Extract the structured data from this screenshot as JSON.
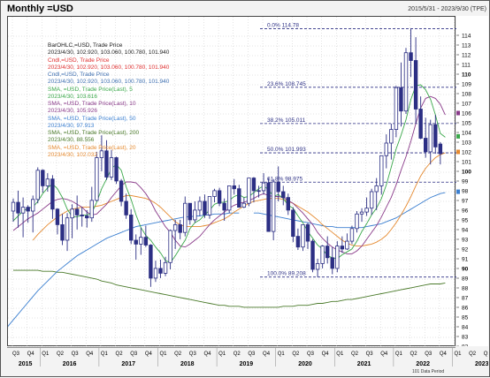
{
  "header": {
    "title": "Monthly =USD",
    "date_range": "2015/5/31 - 2023/9/30 (TPE)"
  },
  "legend": [
    {
      "text": "BarOHLC,=USD, Trade Price",
      "color": "#222222"
    },
    {
      "text": "2023/4/30, 102.920, 103.060, 100.780, 101.940",
      "color": "#222222"
    },
    {
      "text": "Cndl,=USD, Trade Price",
      "color": "#e03030"
    },
    {
      "text": "2023/4/30, 102.920, 103.060, 100.780, 101.940",
      "color": "#e03030"
    },
    {
      "text": "Cndl,=USD, Trade Price",
      "color": "#3e6fb0"
    },
    {
      "text": "2023/4/30, 102.920, 103.060, 100.780, 101.940",
      "color": "#3e6fb0"
    },
    {
      "text": "SMA, =USD, Trade Price(Last), 5",
      "color": "#3aa84a"
    },
    {
      "text": "2023/4/30, 103.616",
      "color": "#3aa84a"
    },
    {
      "text": "SMA, =USD, Trade Price(Last), 10",
      "color": "#8a3b8a"
    },
    {
      "text": "2023/4/30, 105.926",
      "color": "#8a3b8a"
    },
    {
      "text": "SMA, =USD, Trade Price(Last), 50",
      "color": "#3b7fd0"
    },
    {
      "text": "2023/4/30, 97.913",
      "color": "#3b7fd0"
    },
    {
      "text": "SMA, =USD, Trade Price(Last), 200",
      "color": "#4a7a2a"
    },
    {
      "text": "2023/4/30, 88.556",
      "color": "#4a7a2a"
    },
    {
      "text": "SMA, =USD, Trade Price(Last), 20",
      "color": "#e58a30"
    },
    {
      "text": "2023/4/30, 102.032",
      "color": "#e58a30"
    }
  ],
  "footnote": "101 Data Period",
  "chart_data": {
    "type": "candlestick",
    "ylim": [
      82,
      116
    ],
    "y_ticks": [
      82,
      83,
      84,
      85,
      86,
      87,
      88,
      89,
      90,
      91,
      92,
      93,
      94,
      95,
      96,
      97,
      98,
      99,
      100,
      101,
      102,
      103,
      104,
      105,
      106,
      107,
      108,
      109,
      110,
      111,
      112,
      113,
      114
    ],
    "y_ticks_bold": [
      90,
      100,
      110
    ],
    "quarter_labels": [
      "Q3",
      "Q4",
      "Q1",
      "Q2",
      "Q3",
      "Q4",
      "Q1",
      "Q2",
      "Q3",
      "Q4",
      "Q1",
      "Q2",
      "Q3",
      "Q4",
      "Q1",
      "Q2",
      "Q3",
      "Q4",
      "Q1",
      "Q2",
      "Q3",
      "Q4",
      "Q1",
      "Q2",
      "Q3",
      "Q4",
      "Q1",
      "Q2",
      "Q3",
      "Q4",
      "Q1",
      "Q2",
      "Q3",
      "Q4",
      "Q1",
      "Q2"
    ],
    "year_labels": [
      "2015",
      "2016",
      "2017",
      "2018",
      "2019",
      "2020",
      "2021",
      "2022",
      "2023"
    ],
    "fibonacci": [
      {
        "label": "0.0%",
        "value_label": "114.78",
        "level": 114.78
      },
      {
        "label": "23.6%",
        "value_label": "108.745",
        "level": 108.745
      },
      {
        "label": "38.2%",
        "value_label": "105.011",
        "level": 105.011
      },
      {
        "label": "50.0%",
        "value_label": "101.993",
        "level": 101.993
      },
      {
        "label": "61.8%",
        "value_label": "98.975",
        "level": 98.975
      },
      {
        "label": "100.0%",
        "value_label": "89.208",
        "level": 89.208
      }
    ],
    "last_markers": [
      {
        "value": 106,
        "color": "#8a3b8a"
      },
      {
        "value": 103.6,
        "color": "#3aa84a"
      },
      {
        "value": 102,
        "color": "#e58a30"
      },
      {
        "value": 97.9,
        "color": "#3b7fd0"
      }
    ],
    "ohlc": [
      [
        96.0,
        97.3,
        94.9,
        96.9
      ],
      [
        96.9,
        98.1,
        94.3,
        95.8
      ],
      [
        95.8,
        97.4,
        93.3,
        96.4
      ],
      [
        96.4,
        96.6,
        94.8,
        96.0
      ],
      [
        96.0,
        97.6,
        93.8,
        97.2
      ],
      [
        97.2,
        100.5,
        96.8,
        100.2
      ],
      [
        100.2,
        100.3,
        97.9,
        98.6
      ],
      [
        98.6,
        99.9,
        98.0,
        99.3
      ],
      [
        99.3,
        99.7,
        95.2,
        96.2
      ],
      [
        96.2,
        96.3,
        93.6,
        94.6
      ],
      [
        94.6,
        95.7,
        92.5,
        93.0
      ],
      [
        93.0,
        95.8,
        91.9,
        95.3
      ],
      [
        95.3,
        96.7,
        93.2,
        96.2
      ],
      [
        96.2,
        97.6,
        94.1,
        95.6
      ],
      [
        95.6,
        96.4,
        94.4,
        95.5
      ],
      [
        95.5,
        96.1,
        94.3,
        95.3
      ],
      [
        95.3,
        98.5,
        94.9,
        97.1
      ],
      [
        97.1,
        102.1,
        97.0,
        101.5
      ],
      [
        101.5,
        103.8,
        100.1,
        102.2
      ],
      [
        102.2,
        103.3,
        99.2,
        99.5
      ],
      [
        99.5,
        102.3,
        99.2,
        101.5
      ],
      [
        101.5,
        101.6,
        98.8,
        99.1
      ],
      [
        99.1,
        99.3,
        96.5,
        97.0
      ],
      [
        97.0,
        97.8,
        95.2,
        95.6
      ],
      [
        95.6,
        96.2,
        92.6,
        93.0
      ],
      [
        93.0,
        93.6,
        91.0,
        92.6
      ],
      [
        92.6,
        94.3,
        91.5,
        93.3
      ],
      [
        93.3,
        94.5,
        92.3,
        92.5
      ],
      [
        92.5,
        92.6,
        88.2,
        89.1
      ],
      [
        89.1,
        90.9,
        88.7,
        90.1
      ],
      [
        90.1,
        91.0,
        89.1,
        89.6
      ],
      [
        89.6,
        91.3,
        89.3,
        90.7
      ],
      [
        90.7,
        94.1,
        90.0,
        94.0
      ],
      [
        94.0,
        95.1,
        92.1,
        94.6
      ],
      [
        94.6,
        95.1,
        93.1,
        93.8
      ],
      [
        93.8,
        97.5,
        93.4,
        96.8
      ],
      [
        96.8,
        96.8,
        94.6,
        95.1
      ],
      [
        95.1,
        97.0,
        94.8,
        96.1
      ],
      [
        96.1,
        97.5,
        95.5,
        97.0
      ],
      [
        97.0,
        97.7,
        95.3,
        95.6
      ],
      [
        95.6,
        97.4,
        95.2,
        97.5
      ],
      [
        97.5,
        98.3,
        96.9,
        98.1
      ],
      [
        98.1,
        98.4,
        96.5,
        96.8
      ],
      [
        96.8,
        97.3,
        95.0,
        96.1
      ],
      [
        96.1,
        98.4,
        95.8,
        98.6
      ],
      [
        98.6,
        99.3,
        97.7,
        98.3
      ],
      [
        98.3,
        98.7,
        96.4,
        96.4
      ],
      [
        96.4,
        97.4,
        96.3,
        96.8
      ],
      [
        96.8,
        99.4,
        96.5,
        99.4
      ],
      [
        99.4,
        99.5,
        96.9,
        98.1
      ],
      [
        98.1,
        98.6,
        97.4,
        98.1
      ],
      [
        98.1,
        99.9,
        97.7,
        98.9
      ],
      [
        98.9,
        99.4,
        95.4,
        93.9
      ],
      [
        93.9,
        99.3,
        93.0,
        99.0
      ],
      [
        99.0,
        100.6,
        97.0,
        98.0
      ],
      [
        98.0,
        98.6,
        96.6,
        97.4
      ],
      [
        97.4,
        97.8,
        95.6,
        96.1
      ],
      [
        96.1,
        96.4,
        92.8,
        93.4
      ],
      [
        93.4,
        94.2,
        92.0,
        92.3
      ],
      [
        92.3,
        94.5,
        91.9,
        94.6
      ],
      [
        94.6,
        94.8,
        92.1,
        92.9
      ],
      [
        92.9,
        93.1,
        89.7,
        90.0
      ],
      [
        90.0,
        91.1,
        89.2,
        90.6
      ],
      [
        90.6,
        92.5,
        90.1,
        92.4
      ],
      [
        92.4,
        93.4,
        90.6,
        91.2
      ],
      [
        91.2,
        92.3,
        89.5,
        90.1
      ],
      [
        90.1,
        92.9,
        89.7,
        92.4
      ],
      [
        92.4,
        93.4,
        91.7,
        92.1
      ],
      [
        92.1,
        93.7,
        92.0,
        92.9
      ],
      [
        92.9,
        94.5,
        92.6,
        94.2
      ],
      [
        94.2,
        96.0,
        93.8,
        95.7
      ],
      [
        95.7,
        96.3,
        94.9,
        95.9
      ],
      [
        95.9,
        97.4,
        95.5,
        96.3
      ],
      [
        96.3,
        98.3,
        95.6,
        98.0
      ],
      [
        98.0,
        99.4,
        96.1,
        98.6
      ],
      [
        98.6,
        101.0,
        97.7,
        101.7
      ],
      [
        101.7,
        103.9,
        100.4,
        103.0
      ],
      [
        103.0,
        105.0,
        101.3,
        104.4
      ],
      [
        104.4,
        108.9,
        103.6,
        108.7
      ],
      [
        108.7,
        111.3,
        104.7,
        106.3
      ],
      [
        106.3,
        112.8,
        106.0,
        112.3
      ],
      [
        112.3,
        114.8,
        109.8,
        111.5
      ],
      [
        111.5,
        113.9,
        105.0,
        106.5
      ],
      [
        106.5,
        107.8,
        103.4,
        103.5
      ],
      [
        103.5,
        105.6,
        101.5,
        102.1
      ],
      [
        102.1,
        105.4,
        100.8,
        104.9
      ],
      [
        104.9,
        105.9,
        101.9,
        102.6
      ],
      [
        102.9,
        103.1,
        100.8,
        101.9
      ]
    ],
    "sma5": [
      95,
      95.5,
      96,
      96.3,
      96.4,
      97,
      97.8,
      98.4,
      98.8,
      98.3,
      97.4,
      96.2,
      95.4,
      95.4,
      95.6,
      95.6,
      95.8,
      96.9,
      98.3,
      99.3,
      100.4,
      100.8,
      100.2,
      98.5,
      97.2,
      95.6,
      94.3,
      93.5,
      93.0,
      92.3,
      91.7,
      90.9,
      90.7,
      91.4,
      92.2,
      93.0,
      94.2,
      94.8,
      95.1,
      95.6,
      96.1,
      96.7,
      96.9,
      96.9,
      97.1,
      97.5,
      97.7,
      97.4,
      97.5,
      97.9,
      98.3,
      98.6,
      98.2,
      97.5,
      97.7,
      97.3,
      96.6,
      96.3,
      95.5,
      94.8,
      93.9,
      93.2,
      92.5,
      92.1,
      91.4,
      91.2,
      91.1,
      91.5,
      91.8,
      92.1,
      92.9,
      93.9,
      94.7,
      95.6,
      96.3,
      97.3,
      98.7,
      100.5,
      102.4,
      103.8,
      105.4,
      107.5,
      108.9,
      109.0,
      108.5,
      107.5,
      105.9,
      104.0,
      103.6
    ],
    "sma10": [
      94,
      94.4,
      94.8,
      95.2,
      95.5,
      95.8,
      96.2,
      96.6,
      97.0,
      97.2,
      97.3,
      97.2,
      97.0,
      96.7,
      96.4,
      95.9,
      95.6,
      95.7,
      96.2,
      96.7,
      97.4,
      98.0,
      98.6,
      99.0,
      99.0,
      98.9,
      98.4,
      97.8,
      97.0,
      96.0,
      95.2,
      94.4,
      93.8,
      93.0,
      92.4,
      92.3,
      92.6,
      93.0,
      93.4,
      94.0,
      94.6,
      95.1,
      95.5,
      95.9,
      96.3,
      96.6,
      96.8,
      96.9,
      97.1,
      97.3,
      97.6,
      97.8,
      97.6,
      97.5,
      97.5,
      97.4,
      97.1,
      96.8,
      96.3,
      95.8,
      95.2,
      94.6,
      93.8,
      93.2,
      92.7,
      92.3,
      92.0,
      91.8,
      91.6,
      91.6,
      91.9,
      92.4,
      93.1,
      93.8,
      94.5,
      95.4,
      96.4,
      97.4,
      98.7,
      100.2,
      101.6,
      103.2,
      105.0,
      106.6,
      107.6,
      107.8,
      107.6,
      107.0,
      105.9
    ],
    "sma20": [
      null,
      null,
      null,
      null,
      93,
      93.6,
      94.1,
      94.6,
      95.0,
      95.4,
      95.7,
      96.0,
      96.2,
      96.3,
      96.4,
      96.4,
      96.4,
      96.5,
      96.6,
      96.8,
      97.0,
      97.2,
      97.4,
      97.6,
      97.6,
      97.5,
      97.4,
      97.3,
      97.1,
      96.8,
      96.4,
      95.9,
      95.4,
      94.9,
      94.6,
      94.4,
      94.4,
      94.4,
      94.4,
      94.5,
      94.6,
      94.8,
      95.0,
      95.2,
      95.5,
      95.9,
      96.2,
      96.5,
      96.8,
      97.0,
      97.1,
      97.2,
      97.3,
      97.3,
      97.3,
      97.2,
      97.0,
      96.8,
      96.5,
      96.2,
      95.9,
      95.5,
      95.1,
      94.6,
      94.2,
      93.8,
      93.4,
      93.0,
      92.7,
      92.5,
      92.4,
      92.4,
      92.5,
      92.6,
      92.8,
      93.1,
      93.5,
      94.1,
      94.8,
      95.6,
      96.5,
      97.5,
      98.6,
      99.6,
      100.4,
      101.0,
      101.5,
      101.8,
      102.0
    ],
    "sma50": [
      null,
      null,
      null,
      null,
      null,
      null,
      null,
      null,
      null,
      null,
      null,
      null,
      null,
      null,
      null,
      null,
      null,
      null,
      null,
      null,
      null,
      null,
      null,
      null,
      null,
      null,
      null,
      null,
      null,
      null,
      null,
      null,
      null,
      null,
      null,
      null,
      null,
      null,
      null,
      null,
      null,
      null,
      null,
      null,
      null,
      null,
      null,
      null,
      null,
      95.8,
      95.8,
      95.7,
      95.6,
      95.5,
      95.4,
      95.3,
      95.2,
      95.1,
      95.0,
      94.9,
      94.8,
      94.7,
      94.6,
      94.5,
      94.4,
      94.4,
      94.3,
      94.3,
      94.3,
      94.3,
      94.3,
      94.3,
      94.4,
      94.5,
      94.6,
      94.7,
      94.9,
      95.1,
      95.3,
      95.6,
      95.9,
      96.2,
      96.5,
      96.8,
      97.1,
      97.4,
      97.6,
      97.8,
      97.9
    ],
    "sma50_lead": [
      83.0,
      83.6,
      84.2,
      84.8,
      85.4,
      86.0,
      86.6,
      87.2,
      87.8,
      88.3,
      88.8,
      89.3,
      89.8,
      90.2,
      90.6,
      91.0,
      91.4,
      91.7,
      92.0,
      92.3,
      92.6,
      92.9,
      93.2,
      93.4,
      93.6,
      93.8,
      94.0,
      94.2,
      94.4,
      94.5,
      94.6,
      94.7,
      94.8,
      94.9,
      95.0,
      95.1,
      95.2,
      95.3,
      95.4,
      95.4,
      95.5,
      95.5,
      95.6,
      95.6,
      95.7,
      95.7,
      95.7,
      95.8,
      95.8,
      95.8
    ],
    "sma200": [
      89.9,
      89.9,
      89.9,
      89.9,
      89.9,
      89.9,
      89.8,
      89.8,
      89.8,
      89.7,
      89.7,
      89.6,
      89.5,
      89.4,
      89.3,
      89.2,
      89.1,
      89.0,
      88.8,
      88.7,
      88.6,
      88.4,
      88.3,
      88.2,
      88.1,
      88.0,
      87.9,
      87.8,
      87.7,
      87.6,
      87.5,
      87.4,
      87.3,
      87.2,
      87.1,
      87.0,
      86.9,
      86.8,
      86.7,
      86.6,
      86.5,
      86.4,
      86.3,
      86.3,
      86.2,
      86.2,
      86.2,
      86.1,
      86.1,
      86.1,
      86.1,
      86.1,
      86.1,
      86.1,
      86.1,
      86.2,
      86.2,
      86.2,
      86.3,
      86.3,
      86.3,
      86.4,
      86.5,
      86.5,
      86.6,
      86.7,
      86.7,
      86.8,
      86.9,
      86.9,
      87.0,
      87.1,
      87.2,
      87.3,
      87.4,
      87.5,
      87.6,
      87.7,
      87.8,
      87.9,
      88.0,
      88.1,
      88.2,
      88.3,
      88.4,
      88.5,
      88.5,
      88.5,
      88.6
    ],
    "colors": {
      "bar": "#2c2f84",
      "sma5": "#3aa84a",
      "sma10": "#8a3b8a",
      "sma20": "#e58a30",
      "sma50": "#3b7fd0",
      "sma200": "#4a7a2a",
      "fib": "#2c2f84"
    }
  }
}
